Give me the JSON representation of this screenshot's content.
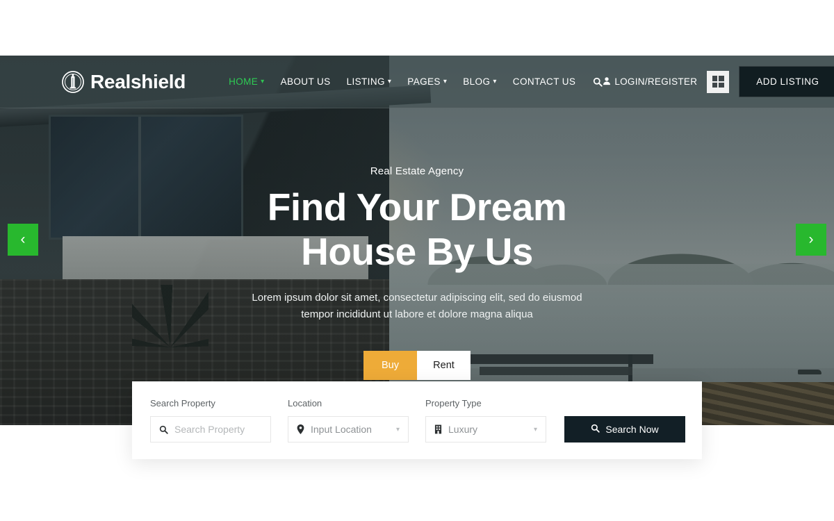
{
  "brand": {
    "name": "Realshield",
    "logo_icon": "tower-circle-logo-icon",
    "accent": "#2ecc54"
  },
  "nav": {
    "items": [
      {
        "label": "HOME",
        "has_dropdown": true,
        "active": true
      },
      {
        "label": "ABOUT US",
        "has_dropdown": false,
        "active": false
      },
      {
        "label": "LISTING",
        "has_dropdown": true,
        "active": false
      },
      {
        "label": "PAGES",
        "has_dropdown": true,
        "active": false
      },
      {
        "label": "BLOG",
        "has_dropdown": true,
        "active": false
      },
      {
        "label": "CONTACT US",
        "has_dropdown": false,
        "active": false
      }
    ],
    "search_icon": "search-icon"
  },
  "header_right": {
    "login_label": "LOGIN/REGISTER",
    "login_icon": "user-icon",
    "grid_icon": "grid-squares-icon",
    "add_listing_label": "ADD LISTING"
  },
  "hero": {
    "eyebrow": "Real Estate Agency",
    "title_line1": "Find Your Dream",
    "title_line2": "House By Us",
    "subtitle_line1": "Lorem ipsum dolor sit amet, consectetur adipiscing elit, sed do eiusmod",
    "subtitle_line2": "tempor incididunt ut labore et dolore magna aliqua",
    "prev_icon": "chevron-left-icon",
    "next_icon": "chevron-right-icon",
    "arrow_color": "#28b82e"
  },
  "tabs": [
    {
      "label": "Buy",
      "active": true,
      "color": "#eeab38"
    },
    {
      "label": "Rent",
      "active": false,
      "color": "#ffffff"
    }
  ],
  "search_form": {
    "fields": [
      {
        "label": "Search Property",
        "placeholder": "Search Property",
        "icon": "search-icon",
        "type": "text"
      },
      {
        "label": "Location",
        "value": "Input Location",
        "icon": "map-pin-icon",
        "type": "select"
      },
      {
        "label": "Property Type",
        "value": "Luxury",
        "icon": "building-icon",
        "type": "select"
      }
    ],
    "submit_label": "Search Now",
    "submit_icon": "search-icon",
    "submit_color": "#121f26"
  }
}
